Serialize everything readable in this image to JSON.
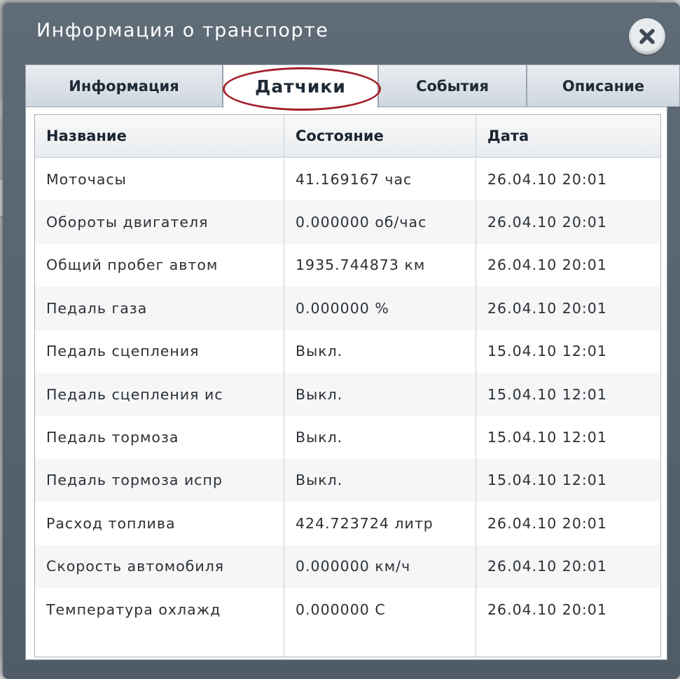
{
  "window": {
    "title": "Информация о транспорте"
  },
  "tabs": [
    {
      "label": "Информация",
      "active": false
    },
    {
      "label": "Датчики",
      "active": true
    },
    {
      "label": "События",
      "active": false
    },
    {
      "label": "Описание",
      "active": false
    }
  ],
  "table": {
    "columns": [
      "Название",
      "Состояние",
      "Дата"
    ],
    "rows": [
      [
        "Моточасы",
        "41.169167 час",
        "26.04.10 20:01"
      ],
      [
        "Обороты двигателя",
        "0.000000 об/час",
        "26.04.10 20:01"
      ],
      [
        "Общий пробег автом",
        "1935.744873 км",
        "26.04.10 20:01"
      ],
      [
        "Педаль газа",
        "0.000000 %",
        "26.04.10 20:01"
      ],
      [
        "Педаль сцепления",
        "Выкл.",
        "15.04.10 12:01"
      ],
      [
        "Педаль сцепления ис",
        "Выкл.",
        "15.04.10 12:01"
      ],
      [
        "Педаль тормоза",
        "Выкл.",
        "15.04.10 12:01"
      ],
      [
        "Педаль тормоза испр",
        "Выкл.",
        "15.04.10 12:01"
      ],
      [
        "Расход топлива",
        "424.723724 литр",
        "26.04.10 20:01"
      ],
      [
        "Скорость автомобиля",
        "0.000000 км/ч",
        "26.04.10 20:01"
      ],
      [
        "Температура охлажд",
        "0.000000 С",
        "26.04.10 20:01"
      ]
    ]
  },
  "colors": {
    "header_bg": "#56626d",
    "highlight_ellipse": "#a31f2a",
    "active_tab": "#ffffff"
  },
  "icons": {
    "close": "close-icon"
  }
}
